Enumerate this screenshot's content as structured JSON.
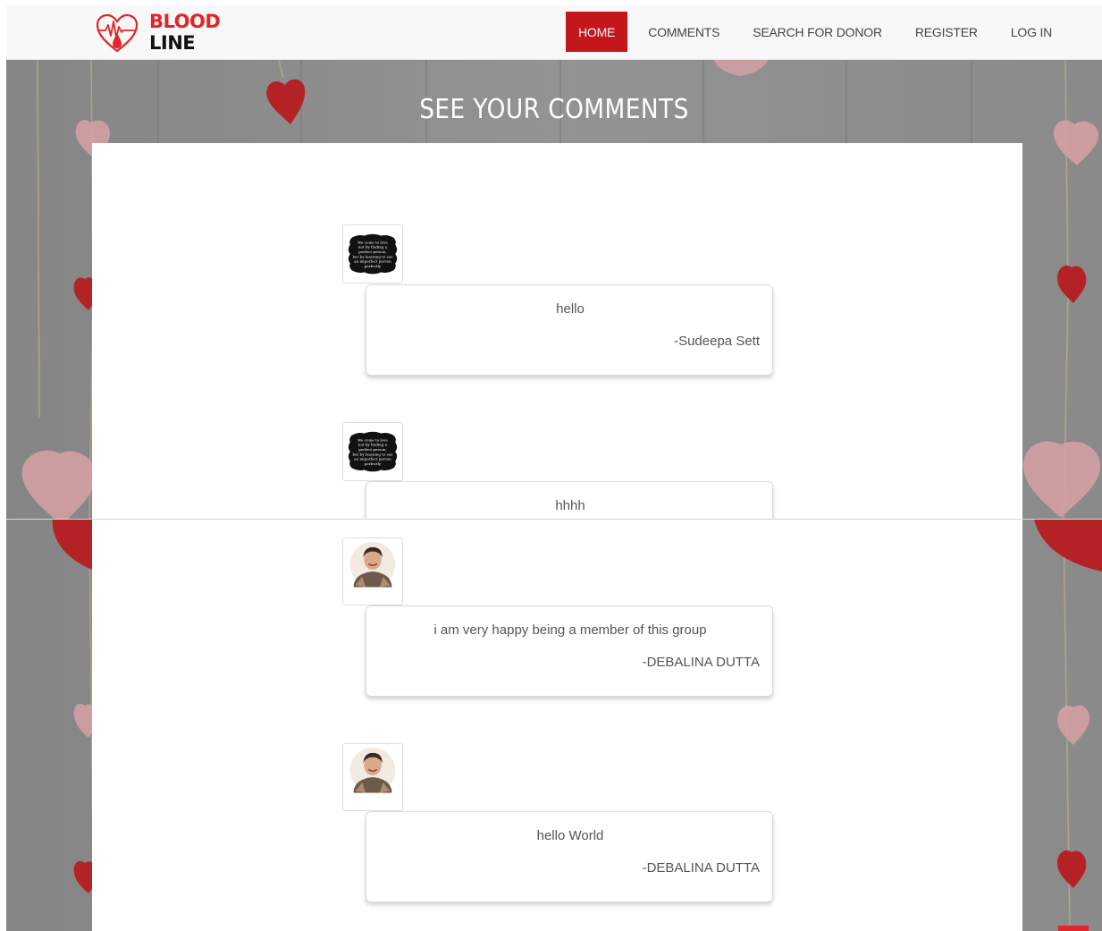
{
  "brand": {
    "word1": "BLOOD",
    "word2": "LINE",
    "accent": "#e0252b",
    "icon": "heart-pulse-drop-icon"
  },
  "nav": {
    "items": [
      {
        "label": "HOME",
        "active": true
      },
      {
        "label": "COMMENTS",
        "active": false
      },
      {
        "label": "SEARCH FOR DONOR",
        "active": false
      },
      {
        "label": "REGISTER",
        "active": false
      },
      {
        "label": "LOG IN",
        "active": false
      }
    ],
    "active_color": "#c4161c"
  },
  "page": {
    "title": "SEE YOUR COMMENTS"
  },
  "comments": [
    {
      "text": "hello",
      "author": "-Sudeepa Sett",
      "avatar": "quote-badge-avatar-icon"
    },
    {
      "text": "hhhh",
      "author": "",
      "avatar": "quote-badge-avatar-icon"
    },
    {
      "text": "i am very happy being a member of this group",
      "author": "-DEBALINA DUTTA",
      "avatar": "woman-portrait-avatar-icon"
    },
    {
      "text": "hello World",
      "author": "-DEBALINA DUTTA",
      "avatar": "woman-portrait-avatar-icon"
    }
  ]
}
